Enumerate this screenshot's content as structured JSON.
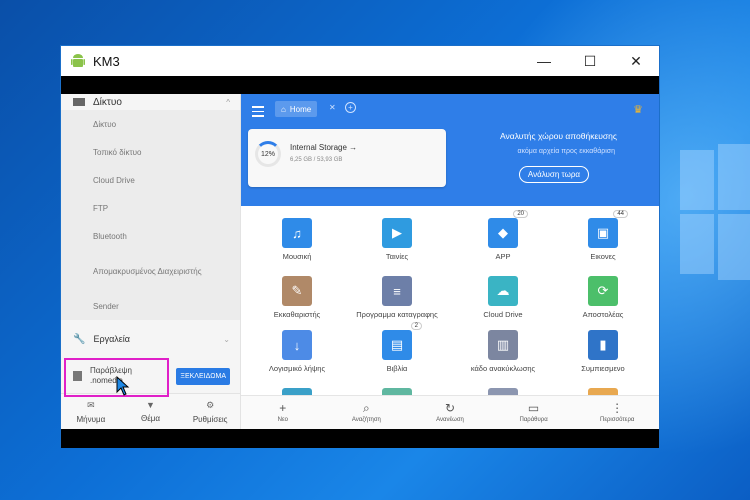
{
  "window": {
    "title": "KM3",
    "controls": [
      "—",
      "☐",
      "✕"
    ]
  },
  "sidebar": {
    "network_header": "Δίκτυο",
    "network_items": [
      "Δίκτυο",
      "Τοπικό δίκτυο",
      "Cloud Drive",
      "FTP",
      "Bluetooth",
      "Απομακρυσμένος Διαχειριστής",
      "Sender"
    ],
    "tools_label": "Εργαλεία",
    "hide_label_line1": "Παράβλεψη",
    "hide_label_line2": ".nomedia",
    "hide_button": "ΞΕΚΛΕΙΔΩΜΑ",
    "bottom": [
      {
        "label": "Μήνυμα",
        "icon": "mail-icon"
      },
      {
        "label": "Θέμα",
        "icon": "shirt-icon"
      },
      {
        "label": "Ρυθμίσεις",
        "icon": "gear-icon"
      }
    ]
  },
  "main": {
    "breadcrumb": "Home",
    "storage": {
      "percent": "12%",
      "title": "Internal Storage →",
      "size": "6,25 GB / 53,93 GB"
    },
    "analysis": {
      "title": "Αναλυτής χώρου αποθήκευσης",
      "subtitle": "ακόμα αρχεία προς εκκαθάριση",
      "button": "Ανάλυση τωρα"
    },
    "grid": [
      {
        "label": "Μουσική",
        "icon": "music-icon",
        "color": "#2f8be8",
        "badge": ""
      },
      {
        "label": "Ταινίες",
        "icon": "video-icon",
        "color": "#2f9be0",
        "badge": ""
      },
      {
        "label": "APP",
        "icon": "android-icon",
        "color": "#2f8be8",
        "badge": "20"
      },
      {
        "label": "Εικονες",
        "icon": "image-icon",
        "color": "#2f8be8",
        "badge": "44"
      },
      {
        "label": "Εκκαθαριστής",
        "icon": "broom-icon",
        "color": "#b08968",
        "badge": ""
      },
      {
        "label": "Προγραμμα καταγραφης",
        "icon": "stack-icon",
        "color": "#6d7fa8",
        "badge": ""
      },
      {
        "label": "Cloud Drive",
        "icon": "cloud-icon",
        "color": "#3ab4c4",
        "badge": ""
      },
      {
        "label": "Αποστολέας",
        "icon": "sync-icon",
        "color": "#4cbf6a",
        "badge": ""
      },
      {
        "label": "Λογισμικό λήψης",
        "icon": "download-icon",
        "color": "#4d8be6",
        "badge": ""
      },
      {
        "label": "Βιβλία",
        "icon": "book-icon",
        "color": "#2f8be8",
        "badge": "2"
      },
      {
        "label": "κάδο ανακύκλωσης",
        "icon": "trash-icon",
        "color": "#7c86a0",
        "badge": ""
      },
      {
        "label": "Συμπιεσμενο",
        "icon": "zip-icon",
        "color": "#2f74c8",
        "badge": ""
      }
    ],
    "bottom_nav": [
      {
        "label": "Νεο",
        "icon": "plus-icon"
      },
      {
        "label": "Αναζήτηση",
        "icon": "search-icon"
      },
      {
        "label": "Ανανέωση",
        "icon": "refresh-icon"
      },
      {
        "label": "Παράθυρα",
        "icon": "windows-icon"
      },
      {
        "label": "Περισσότερα",
        "icon": "more-icon"
      }
    ]
  }
}
